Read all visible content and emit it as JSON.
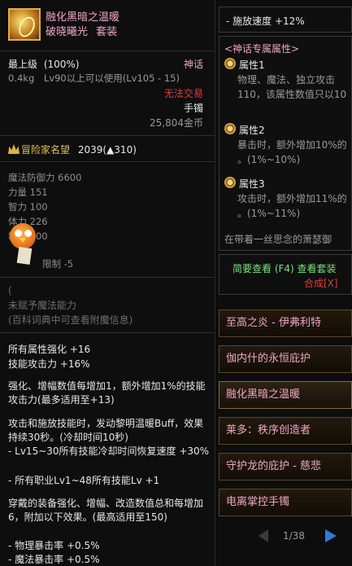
{
  "item": {
    "name": "融化黑暗之温暖",
    "set_name": "破晓曦光",
    "set_tag": "套装",
    "grade": "最上级",
    "grade_pct": "(100%)",
    "rarity": "神话",
    "weight": "0.4kg",
    "level_req": "Lv90以上可以使用(Lv105 - 15)",
    "trade": "无法交易",
    "slot": "手镯",
    "price": "25,804金币",
    "fame_label": "冒险家名望",
    "fame_value": "2039",
    "fame_delta": "(▲310)",
    "stats": [
      "魔法防御力 6600",
      "力量 151",
      "智力 100",
      "体力 226",
      "精神 100"
    ],
    "limit": "限制 -5",
    "enchant_paren_partial": "(",
    "enchant_none": "未赋予魔法能力",
    "enchant_hint": "(百科词典中可查看附魔信息)",
    "attr1": "所有属性强化 +16",
    "attr2": "技能攻击力 +16%",
    "desc1": "强化、增幅数值每增加1，额外增加1%的技能攻击力(最多适用至+13)",
    "desc2": "攻击和施放技能时，发动黎明温暖Buff，效果持续30秒。(冷却时间10秒)",
    "desc3": "- Lv15~30所有技能冷却时间恢复速度 +30%",
    "desc4": "- 所有职业Lv1~48所有技能Lv +1",
    "desc5": "穿戴的装备强化、增幅、改造数值总和每增加6，附加以下效果。(最高适用至150)",
    "desc6": "- 物理暴击率 +0.5%",
    "desc7": "- 魔法暴击率 +0.5%"
  },
  "side": {
    "cast_speed": "- 施放速度 +12%",
    "myth_header": "<神话专属属性>",
    "attr1_label": "属性1",
    "attr1_text1": "物理、魔法、独立攻击",
    "attr1_text2": "110，该属性数值只以10",
    "attr2_label": "属性2",
    "attr2_text1": "暴击时，额外增加10%的",
    "attr2_text2": "。(1%~10%)",
    "attr3_label": "属性3",
    "attr3_text1": "攻击时，额外增加11%的",
    "attr3_text2": "。(1%~11%)",
    "flavor": "在带着一丝思念的萧瑟御",
    "brief": "简要查看 (F4) 查看套装",
    "synth": "合成[X]",
    "list": [
      "至高之炎 - 伊弗利特",
      "伽内什的永恒庇护",
      "融化黑暗之温暖",
      "莱多：秩序创造者",
      "守护龙的庇护 - 慈悲",
      "电离掌控手镯"
    ],
    "page": "1/38"
  }
}
